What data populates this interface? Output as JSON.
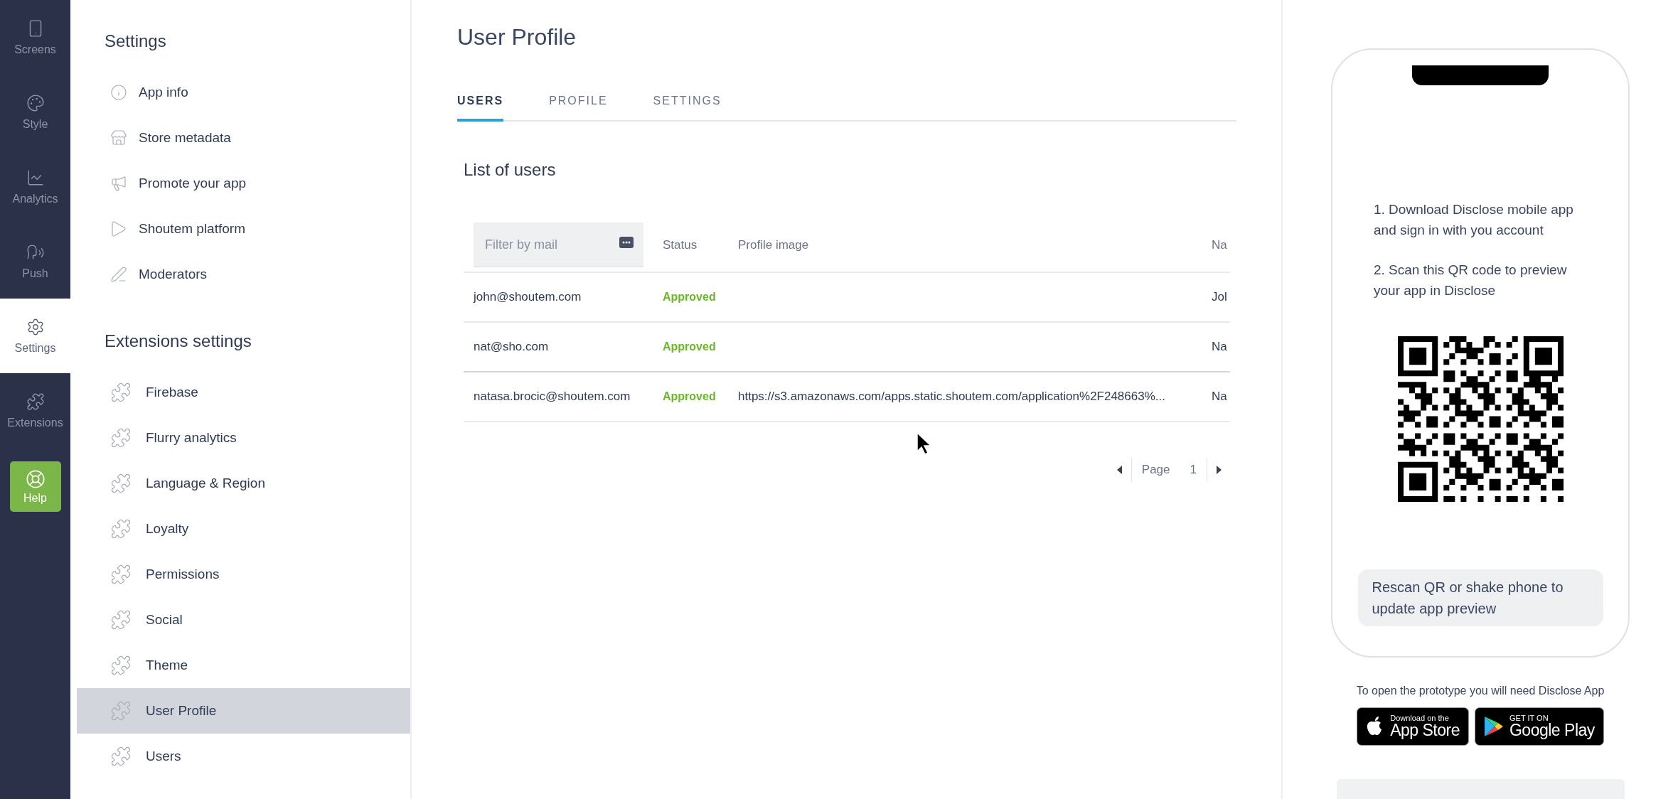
{
  "nav_rail": {
    "items": [
      {
        "label": "Screens",
        "selected": false,
        "kind": "nav"
      },
      {
        "label": "Style",
        "selected": false,
        "kind": "nav"
      },
      {
        "label": "Analytics",
        "selected": false,
        "kind": "nav"
      },
      {
        "label": "Push",
        "selected": false,
        "kind": "nav"
      },
      {
        "label": "Settings",
        "selected": true,
        "kind": "nav"
      },
      {
        "label": "Extensions",
        "selected": false,
        "kind": "nav"
      },
      {
        "label": "Help",
        "selected": false,
        "kind": "help"
      }
    ]
  },
  "settings_panel": {
    "title": "Settings",
    "items": [
      {
        "label": "App info",
        "selected": false
      },
      {
        "label": "Store metadata",
        "selected": false
      },
      {
        "label": "Promote your app",
        "selected": false
      },
      {
        "label": "Shoutem platform",
        "selected": false
      },
      {
        "label": "Moderators",
        "selected": false
      }
    ],
    "extensions_title": "Extensions settings",
    "extensions": [
      {
        "label": "Firebase",
        "selected": false
      },
      {
        "label": "Flurry analytics",
        "selected": false
      },
      {
        "label": "Language & Region",
        "selected": false
      },
      {
        "label": "Loyalty",
        "selected": false
      },
      {
        "label": "Permissions",
        "selected": false
      },
      {
        "label": "Social",
        "selected": false
      },
      {
        "label": "Theme",
        "selected": false
      },
      {
        "label": "User Profile",
        "selected": true
      },
      {
        "label": "Users",
        "selected": false
      }
    ]
  },
  "main": {
    "title": "User Profile",
    "tabs": [
      {
        "label": "USERS",
        "selected": true
      },
      {
        "label": "PROFILE",
        "selected": false
      },
      {
        "label": "SETTINGS",
        "selected": false
      }
    ],
    "section_title": "List of users",
    "filter": {
      "placeholder": "Filter by mail"
    },
    "columns": [
      "Status",
      "Profile image",
      "Na"
    ],
    "rows": [
      {
        "email": "john@shoutem.com",
        "status": "Approved",
        "name": "Jol"
      },
      {
        "email": "nat@sho.com",
        "status": "Approved",
        "name": "Na"
      },
      {
        "email": "natasa.brocic@shoutem.com",
        "status": "Approved",
        "profile_image": "https://s3.amazonaws.com/apps.static.shoutem.com/application%2F248663%...",
        "name": "Na"
      }
    ],
    "pagination": {
      "label": "Page",
      "page": "1"
    }
  },
  "preview": {
    "steps": [
      "1. Download Disclose mobile app and sign in with you account",
      "2. Scan this QR code to preview your app in Disclose"
    ],
    "rescan_note": "Rescan QR or shake phone to update app preview",
    "prompt": "To open the prototype you will need Disclose App",
    "badges": [
      {
        "kind": "apple",
        "small": "Download on the",
        "large": "App Store"
      },
      {
        "kind": "google",
        "small": "GET IT ON",
        "large": "Google Play"
      }
    ]
  }
}
